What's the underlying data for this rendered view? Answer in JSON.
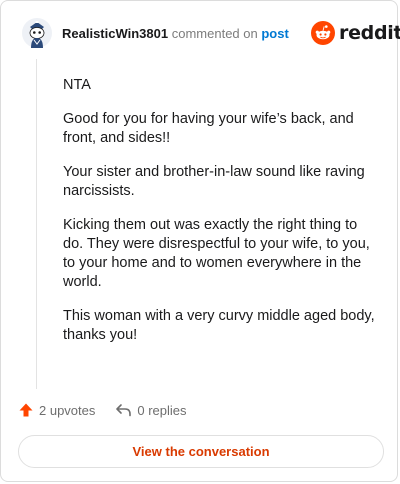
{
  "header": {
    "username": "RealisticWin3801",
    "action_text": "commented on",
    "link_text": "post",
    "brand": "reddit"
  },
  "comment": {
    "paragraphs": [
      "NTA",
      "Good for you for having your wife’s back, and front, and sides!!",
      "Your sister and brother-in-law sound like raving narcissists.",
      "Kicking them out was exactly the right thing to do. They were disrespectful to your wife, to you, to your home and to women everywhere in the world.",
      "This woman with a very curvy middle aged body, thanks you!"
    ]
  },
  "footer": {
    "upvotes_label": "2 upvotes",
    "replies_label": "0 replies"
  },
  "cta": {
    "label": "View the conversation"
  },
  "colors": {
    "reddit_orange": "#ff4500",
    "link_blue": "#0079d3",
    "cta_text": "#d93a00",
    "muted": "#7c7c7c"
  },
  "icons": [
    "avatar-snoo",
    "reddit-logo-icon",
    "upvote-arrow-icon",
    "reply-arrow-icon"
  ]
}
